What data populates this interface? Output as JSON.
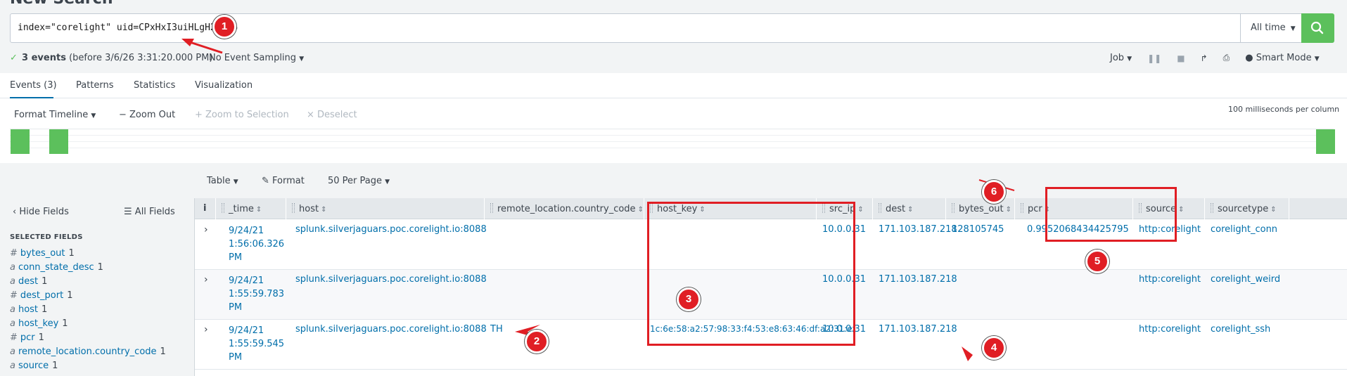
{
  "search": {
    "title_fragment": "New Search",
    "query": "index=\"corelight\" uid=CPxHxI3uiHLgH2I196",
    "time_range": "All time"
  },
  "status": {
    "event_count": "3 events",
    "before": "(before 3/6/26 3:31:20.000 PM)",
    "sampling": "No Event Sampling"
  },
  "job_toolbar": {
    "job": "Job",
    "smart_mode": "Smart Mode"
  },
  "tabs": [
    "Events (3)",
    "Patterns",
    "Statistics",
    "Visualization"
  ],
  "timeline": {
    "format": "Format Timeline",
    "zoom_out": "− Zoom Out",
    "zoom_selection": "+ Zoom to Selection",
    "deselect": "× Deselect",
    "resolution": "100 milliseconds per column"
  },
  "table_toolbar": {
    "table": "Table",
    "format": "Format",
    "per_page": "50 Per Page"
  },
  "fields_panel": {
    "hide": "Hide Fields",
    "all": "All Fields",
    "selected_title": "SELECTED FIELDS",
    "fields": [
      {
        "type": "#",
        "name": "bytes_out",
        "count": "1"
      },
      {
        "type": "a",
        "name": "conn_state_desc",
        "count": "1"
      },
      {
        "type": "a",
        "name": "dest",
        "count": "1"
      },
      {
        "type": "#",
        "name": "dest_port",
        "count": "1"
      },
      {
        "type": "a",
        "name": "host",
        "count": "1"
      },
      {
        "type": "a",
        "name": "host_key",
        "count": "1"
      },
      {
        "type": "#",
        "name": "pcr",
        "count": "1"
      },
      {
        "type": "a",
        "name": "remote_location.country_code",
        "count": "1"
      },
      {
        "type": "a",
        "name": "source",
        "count": "1"
      }
    ]
  },
  "table": {
    "info_header": "i",
    "columns": [
      "_time",
      "host",
      "remote_location.country_code",
      "host_key",
      "src_ip",
      "dest",
      "bytes_out",
      "pcr",
      "source",
      "sourcetype"
    ],
    "rows": [
      {
        "time": "9/24/21 1:56:06.326 PM",
        "host": "splunk.silverjaguars.poc.corelight.io:8088",
        "country": "",
        "host_key": "",
        "src_ip": "10.0.0.31",
        "dest": "171.103.187.218",
        "bytes_out": "128105745",
        "pcr": "0.9952068434425795",
        "source": "http:corelight",
        "sourcetype": "corelight_conn"
      },
      {
        "time": "9/24/21 1:55:59.783 PM",
        "host": "splunk.silverjaguars.poc.corelight.io:8088",
        "country": "",
        "host_key": "",
        "src_ip": "10.0.0.31",
        "dest": "171.103.187.218",
        "bytes_out": "",
        "pcr": "",
        "source": "http:corelight",
        "sourcetype": "corelight_weird"
      },
      {
        "time": "9/24/21 1:55:59.545 PM",
        "host": "splunk.silverjaguars.poc.corelight.io:8088",
        "country": "TH",
        "host_key": "1c:6e:58:a2:57:98:33:f4:53:e8:63:46:df:a2:31:ef",
        "src_ip": "10.0.0.31",
        "dest": "171.103.187.218",
        "bytes_out": "",
        "pcr": "",
        "source": "http:corelight",
        "sourcetype": "corelight_ssh"
      }
    ]
  },
  "annotations": {
    "badges": [
      "1",
      "2",
      "3",
      "4",
      "5",
      "6"
    ],
    "color": "#e01e24"
  },
  "colors": {
    "accent": "#006eaa",
    "go": "#5cc05c"
  }
}
